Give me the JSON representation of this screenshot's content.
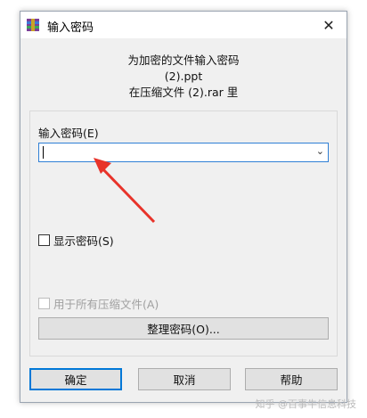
{
  "window": {
    "title": "输入密码",
    "close_glyph": "✕"
  },
  "info": {
    "line1": "为加密的文件输入密码",
    "line2": "(2).ppt",
    "line3": "在压缩文件 (2).rar 里"
  },
  "password": {
    "label": "输入密码(E)",
    "value": "",
    "dropdown_glyph": "⌄"
  },
  "show_password": {
    "label": "显示密码(S)",
    "checked": false
  },
  "use_for_all": {
    "label": "用于所有压缩文件(A)",
    "checked": false,
    "disabled": true
  },
  "buttons": {
    "organize": "整理密码(O)...",
    "ok": "确定",
    "cancel": "取消",
    "help": "帮助"
  },
  "annotation": {
    "arrow_color": "#e8332a"
  },
  "watermark": "知乎 @百事牛信息科技"
}
